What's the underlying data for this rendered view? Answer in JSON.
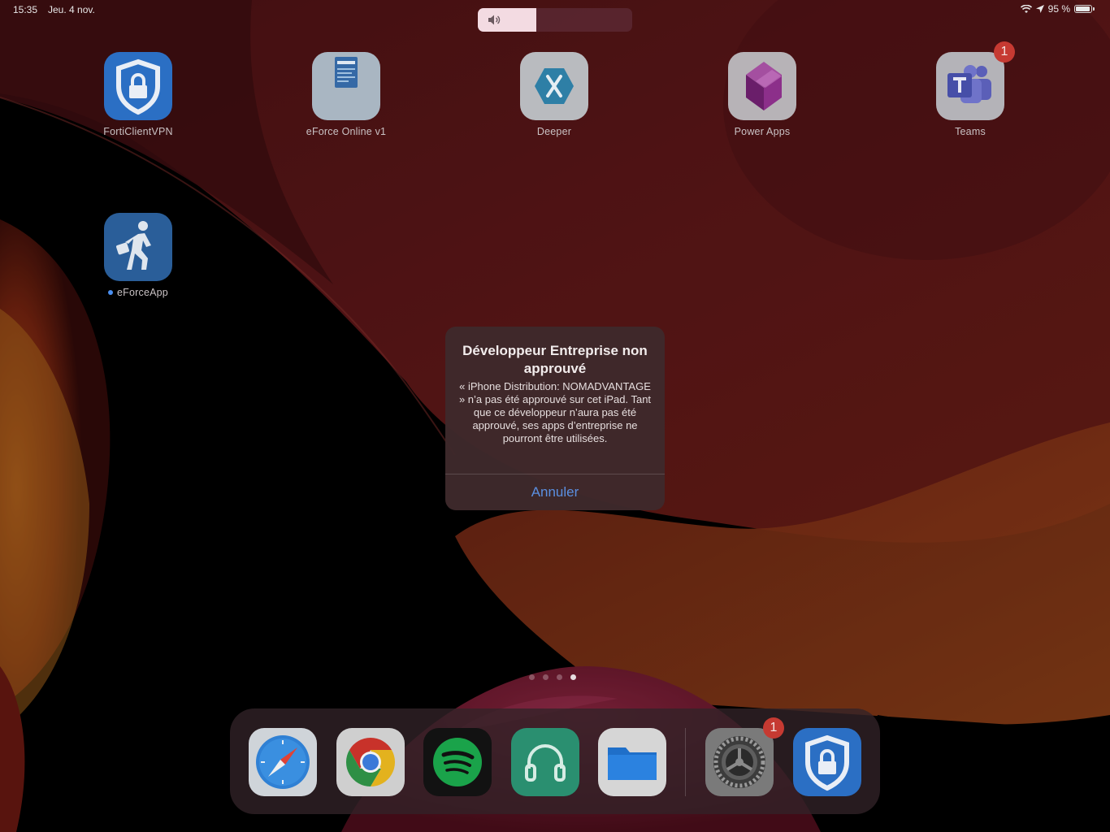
{
  "status_bar": {
    "time": "15:35",
    "date": "Jeu. 4 nov.",
    "battery_text": "95 %",
    "battery_level": 0.95,
    "icons": [
      "wifi-icon",
      "location-icon",
      "battery-icon"
    ]
  },
  "volume": {
    "level": 0.38,
    "icon": "speaker-icon"
  },
  "home_apps": [
    {
      "label": "FortiClientVPN",
      "icon": "shield-lock-icon"
    },
    {
      "label": "eForce Online v1",
      "icon": "document-screenshot-icon"
    },
    {
      "label": "Deeper",
      "icon": "xamarin-hexagon-icon"
    },
    {
      "label": "Power Apps",
      "icon": "power-apps-icon"
    },
    {
      "label": "Teams",
      "icon": "teams-icon",
      "badge": "1"
    },
    {
      "label": "eForceApp",
      "icon": "walking-person-icon",
      "new_dot": true
    }
  ],
  "page_indicator": {
    "count": 4,
    "current": 4
  },
  "dock": {
    "apps": [
      {
        "name": "Safari",
        "icon": "compass-icon"
      },
      {
        "name": "Chrome",
        "icon": "chrome-icon"
      },
      {
        "name": "Spotify",
        "icon": "spotify-icon"
      },
      {
        "name": "Audio",
        "icon": "headphones-icon"
      },
      {
        "name": "Files",
        "icon": "folder-icon"
      },
      {
        "name": "Settings",
        "icon": "gear-icon",
        "badge": "1"
      },
      {
        "name": "FortiClientVPN",
        "icon": "shield-lock-icon"
      }
    ]
  },
  "alert": {
    "title": "Développeur Entreprise non approuvé",
    "message": "« iPhone Distribution: NOMADVANTAGE » n’a pas été approuvé sur cet iPad. Tant que ce développeur n’aura pas été approuvé, ses apps d’entreprise ne pourront être utilisées.",
    "button": "Annuler"
  },
  "colors": {
    "alert_button": "#5b8fe0",
    "badge": "#c63a32",
    "wallpaper_red": "#6b1b1e",
    "wallpaper_orange": "#a8431f"
  }
}
